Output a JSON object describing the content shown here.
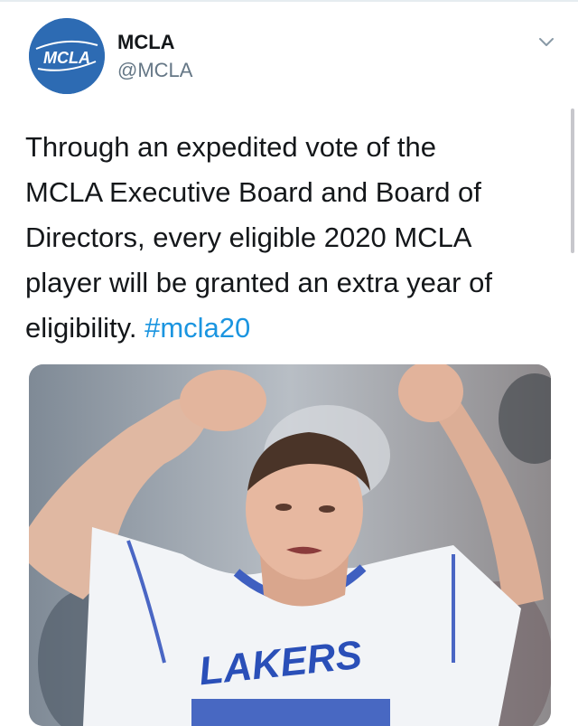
{
  "colors": {
    "brand_blue": "#2d6bb3",
    "hashtag_blue": "#1b95e0",
    "handle_gray": "#657786",
    "text": "#14171a"
  },
  "tweet": {
    "author": {
      "display_name": "MCLA",
      "handle": "@MCLA",
      "avatar_icon": "mcla-logo",
      "avatar_text": "MCLA"
    },
    "menu_icon": "chevron-down-icon",
    "text_lines": [
      "Through an expedited vote of the",
      "MCLA Executive Board and Board of",
      "Directors, every eligible 2020 MCLA",
      "player will be granted an extra year of"
    ],
    "text_last_line": "eligibility. ",
    "hashtag": "#mcla20",
    "media": {
      "type": "photo",
      "jersey_text": "LAKERS"
    }
  }
}
